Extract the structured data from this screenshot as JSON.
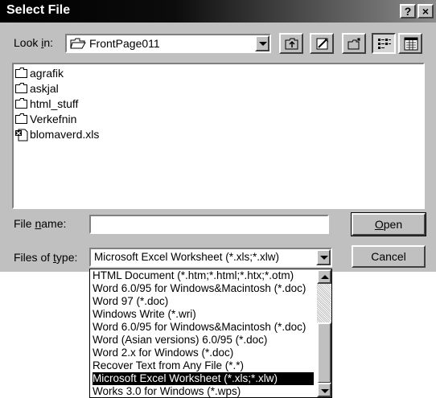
{
  "window": {
    "title": "Select File",
    "help_label": "?",
    "close_label": "×"
  },
  "lookin": {
    "label_pre": "Look ",
    "label_key": "i",
    "label_post": "n:",
    "value": "FrontPage011"
  },
  "files": [
    {
      "name": "agrafik",
      "kind": "folder"
    },
    {
      "name": "askjal",
      "kind": "folder"
    },
    {
      "name": "html_stuff",
      "kind": "folder"
    },
    {
      "name": "Verkefnin",
      "kind": "folder"
    },
    {
      "name": "blomaverd.xls",
      "kind": "excel-file"
    }
  ],
  "filename": {
    "label_pre": "File ",
    "label_key": "n",
    "label_post": "ame:",
    "value": ""
  },
  "filetype": {
    "label_pre": "Files of ",
    "label_key": "t",
    "label_post": "ype:",
    "value": "Microsoft Excel Worksheet (*.xls;*.xlw)",
    "options": [
      "HTML Document (*.htm;*.html;*.htx;*.otm)",
      "Word 6.0/95 for Windows&Macintosh (*.doc)",
      "Word 97 (*.doc)",
      "Windows Write (*.wri)",
      "Word 6.0/95 for Windows&Macintosh (*.doc)",
      "Word (Asian versions) 6.0/95 (*.doc)",
      "Word 2.x for Windows (*.doc)",
      "Recover Text from Any File (*.*)",
      "Microsoft Excel Worksheet (*.xls;*.xlw)",
      "Works 3.0 for Windows (*.wps)"
    ],
    "selected_index": 8
  },
  "buttons": {
    "open_key": "O",
    "open_rest": "pen",
    "cancel_label": "Cancel"
  },
  "icons": {
    "up_folder": "up-one-level-icon",
    "web_folder": "web-folder-icon",
    "new_folder": "new-folder-icon",
    "list_view": "list-view-icon",
    "details_view": "details-view-icon"
  }
}
